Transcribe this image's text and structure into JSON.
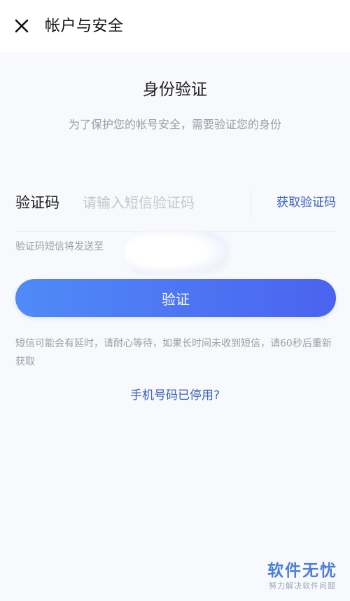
{
  "header": {
    "title": "帐户与安全",
    "close_icon": "close-icon"
  },
  "main": {
    "title": "身份验证",
    "subtitle": "为了保护您的帐号安全，需要验证您的身份",
    "code_label": "验证码",
    "code_placeholder": "请输入短信验证码",
    "code_value": "",
    "get_code_label": "获取验证码",
    "sent_to_text": "验证码短信将发送至",
    "verify_label": "验证",
    "delay_note": "短信可能会有延时，请耐心等待，如果长时间未收到短信，请60秒后重新获取",
    "phone_disabled_link": "手机号码已停用?"
  },
  "watermark": {
    "main": "软件无忧",
    "sub": "努力解决软件问题"
  },
  "colors": {
    "accent": "#4a63ef",
    "link": "#3b63b8",
    "muted": "#9a9da5",
    "background": "#f8f9fc"
  }
}
